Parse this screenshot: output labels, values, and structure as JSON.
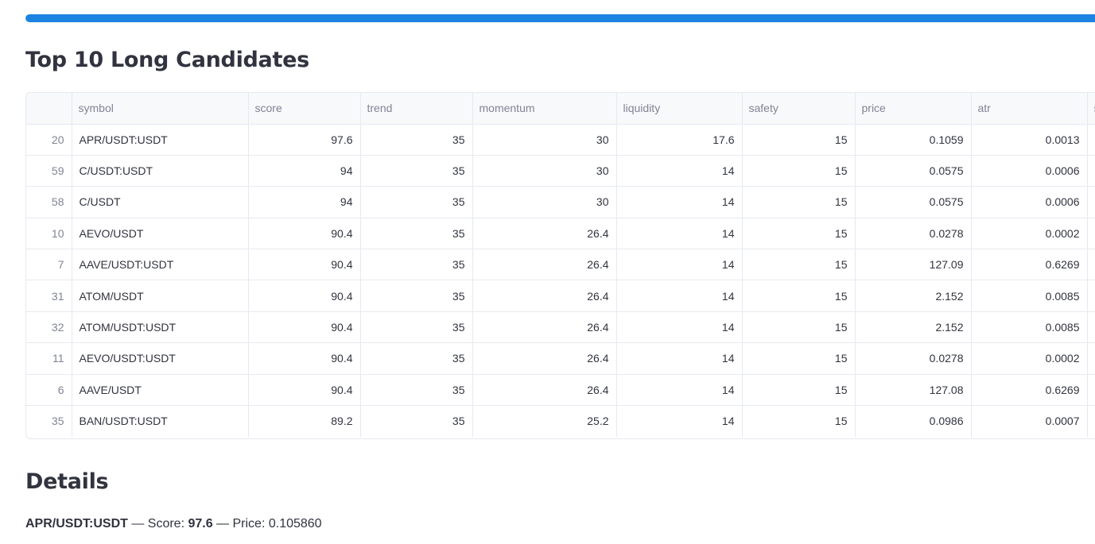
{
  "progress": {
    "value_percent": 100,
    "color": "#1c83e1"
  },
  "top_section": {
    "title": "Top 10 Long Candidates"
  },
  "table": {
    "columns": [
      "",
      "symbol",
      "score",
      "trend",
      "momentum",
      "liquidity",
      "safety",
      "price",
      "atr",
      "s"
    ],
    "rows": [
      [
        "20",
        "APR/USDT:USDT",
        "97.6",
        "35",
        "30",
        "17.6",
        "15",
        "0.1059",
        "0.0013",
        ""
      ],
      [
        "59",
        "C/USDT:USDT",
        "94",
        "35",
        "30",
        "14",
        "15",
        "0.0575",
        "0.0006",
        ""
      ],
      [
        "58",
        "C/USDT",
        "94",
        "35",
        "30",
        "14",
        "15",
        "0.0575",
        "0.0006",
        ""
      ],
      [
        "10",
        "AEVO/USDT",
        "90.4",
        "35",
        "26.4",
        "14",
        "15",
        "0.0278",
        "0.0002",
        ""
      ],
      [
        "7",
        "AAVE/USDT:USDT",
        "90.4",
        "35",
        "26.4",
        "14",
        "15",
        "127.09",
        "0.6269",
        ""
      ],
      [
        "31",
        "ATOM/USDT",
        "90.4",
        "35",
        "26.4",
        "14",
        "15",
        "2.152",
        "0.0085",
        ""
      ],
      [
        "32",
        "ATOM/USDT:USDT",
        "90.4",
        "35",
        "26.4",
        "14",
        "15",
        "2.152",
        "0.0085",
        ""
      ],
      [
        "11",
        "AEVO/USDT:USDT",
        "90.4",
        "35",
        "26.4",
        "14",
        "15",
        "0.0278",
        "0.0002",
        ""
      ],
      [
        "6",
        "AAVE/USDT",
        "90.4",
        "35",
        "26.4",
        "14",
        "15",
        "127.08",
        "0.6269",
        ""
      ],
      [
        "35",
        "BAN/USDT:USDT",
        "89.2",
        "35",
        "25.2",
        "14",
        "15",
        "0.0986",
        "0.0007",
        ""
      ]
    ]
  },
  "details": {
    "title": "Details",
    "symbol": "APR/USDT:USDT",
    "score_label": " — Score: ",
    "score": "97.6",
    "price_label": " — Price: ",
    "price": "0.105860"
  }
}
